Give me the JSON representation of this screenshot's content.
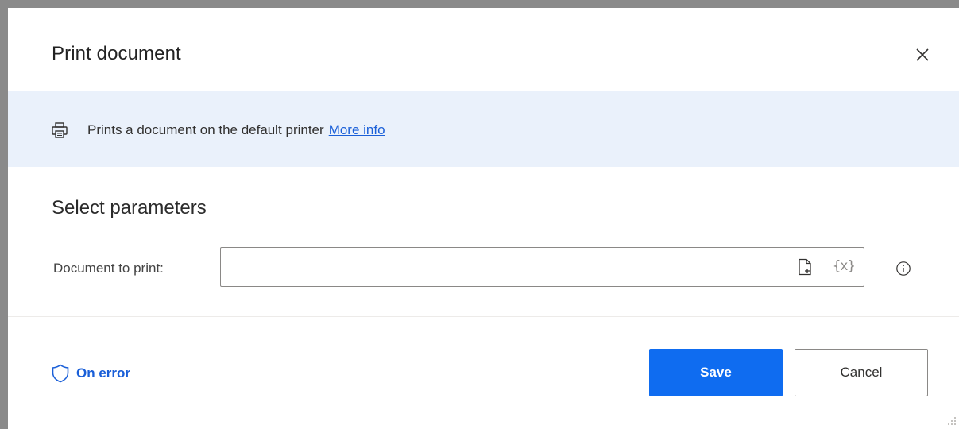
{
  "dialog": {
    "title": "Print document",
    "close_icon": "close-icon"
  },
  "banner": {
    "icon": "printer-icon",
    "description": "Prints a document on the default printer",
    "link_text": "More info"
  },
  "parameters": {
    "section_title": "Select parameters",
    "document_field": {
      "label": "Document to print:",
      "value": "",
      "placeholder": "",
      "file_picker_icon": "file-icon",
      "variable_label": "{x}",
      "info_icon": "info-icon"
    }
  },
  "footer": {
    "on_error_label": "On error",
    "on_error_icon": "shield-icon",
    "save_label": "Save",
    "cancel_label": "Cancel"
  },
  "colors": {
    "accent": "#0f6cf0",
    "link": "#1a5fd8",
    "banner_bg": "#eaf1fb"
  }
}
